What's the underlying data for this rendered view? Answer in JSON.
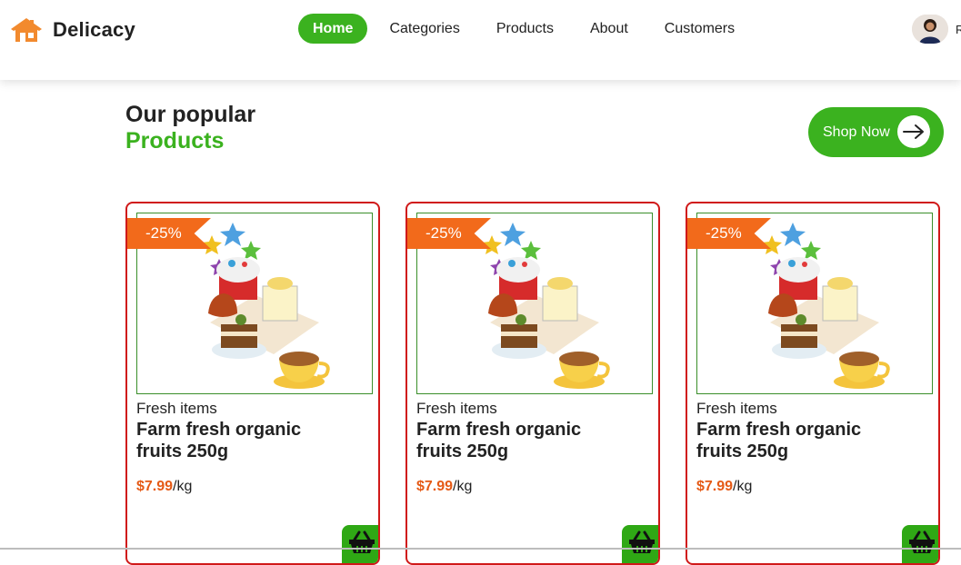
{
  "header": {
    "brand_name": "Delicacy",
    "nav": [
      {
        "label": "Home",
        "active": true
      },
      {
        "label": "Categories",
        "active": false
      },
      {
        "label": "Products",
        "active": false
      },
      {
        "label": "About",
        "active": false
      },
      {
        "label": "Customers",
        "active": false
      }
    ],
    "user_name_partial": "R"
  },
  "hero": {
    "title_line1": "Our popular",
    "title_line2": "Products",
    "shop_button_label": "Shop Now"
  },
  "products": [
    {
      "discount": "-25%",
      "category": "Fresh items",
      "name": "Farm fresh organic fruits 250g",
      "price": "$7.99",
      "unit": "/kg"
    },
    {
      "discount": "-25%",
      "category": "Fresh items",
      "name": "Farm fresh organic fruits 250g",
      "price": "$7.99",
      "unit": "/kg"
    },
    {
      "discount": "-25%",
      "category": "Fresh items",
      "name": "Farm fresh organic fruits 250g",
      "price": "$7.99",
      "unit": "/kg"
    }
  ],
  "colors": {
    "brand_green": "#3bb21f",
    "accent_orange": "#f26a1b",
    "card_border": "#d01919",
    "price_color": "#e55a16"
  },
  "icons": {
    "brand": "house-logo-icon",
    "shop_button": "arrow-right-icon",
    "card_action": "basket-icon"
  }
}
